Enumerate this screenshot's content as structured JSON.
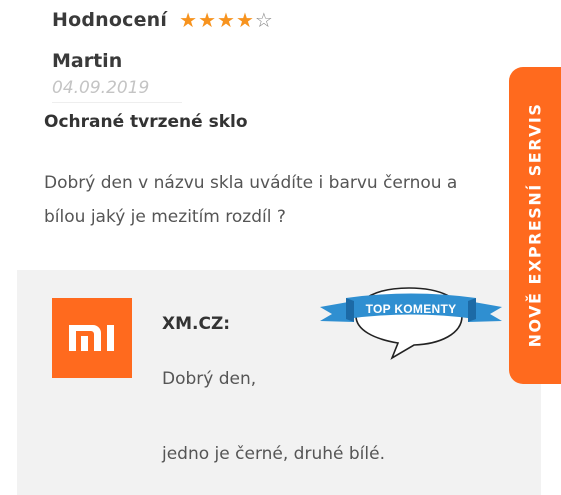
{
  "review": {
    "rating_label": "Hodnocení",
    "rating": {
      "value": 4,
      "max": 5
    },
    "author": "Martin",
    "date": "04.09.2019",
    "title": "Ochrané tvrzené sklo",
    "text": "Dobrý den v názvu skla uvádíte i barvu černou a bílou jaký je mezitím rozdíl ?"
  },
  "reply": {
    "author": "XM.CZ:",
    "line1": "Dobrý den,",
    "line2": "jedno je černé, druhé bílé."
  },
  "badge": {
    "text": "TOP KOMENTY",
    "color": "#2f8fd1"
  },
  "side_tab": {
    "label": "NOVĚ EXPRESNÍ SERVIS"
  },
  "colors": {
    "accent": "#ff6a1e",
    "star": "#f7931e",
    "reply_bg": "#f2f2f2"
  },
  "icons": {
    "logo": "mi-logo",
    "star_filled": "star-filled-icon",
    "star_empty": "star-outline-icon"
  }
}
